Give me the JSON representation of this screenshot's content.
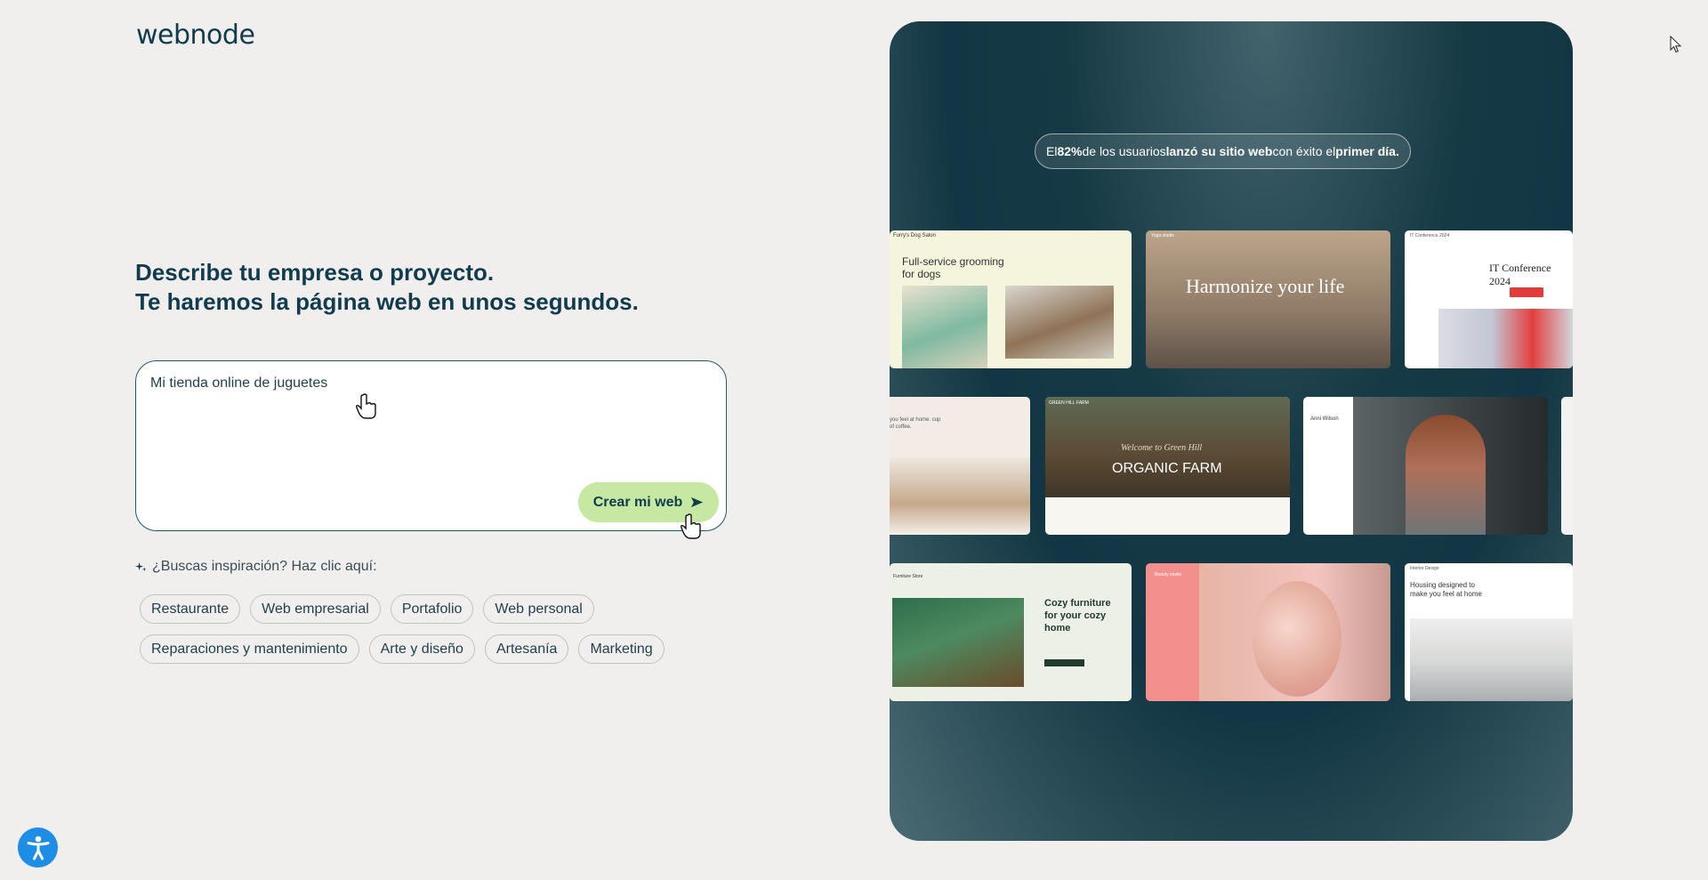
{
  "brand": {
    "logo": "webnode"
  },
  "headline": {
    "line1": "Describe tu empresa o proyecto.",
    "line2": "Te haremos la página web en unos segundos."
  },
  "prompt": {
    "value": "Mi tienda online de juguetes",
    "button_label": "Crear mi web"
  },
  "inspiration": {
    "label": "¿Buscas inspiración? Haz clic aquí:",
    "chips": [
      "Restaurante",
      "Web empresarial",
      "Portafolio",
      "Web personal",
      "Reparaciones y mantenimiento",
      "Arte y diseño",
      "Artesanía",
      "Marketing"
    ]
  },
  "hero": {
    "badge": {
      "p1": "El ",
      "b1": "82%",
      "p2": " de los usuarios ",
      "b2": "lanzó su sitio web",
      "p3": " con éxito el ",
      "b3": "primer día."
    },
    "thumbnails": {
      "dog_salon": {
        "brand": "Furry's Dog Salon",
        "headline": "Full-service grooming for dogs"
      },
      "yoga": {
        "brand": "Yoga studio",
        "headline": "Harmonize your life"
      },
      "conference": {
        "brand": "IT Conference 2024",
        "headline": "IT Conference 2024"
      },
      "coffee": {
        "text": "you feel at home. cup of coffee."
      },
      "farm": {
        "brand": "GREEN HILL FARM",
        "script": "Welcome to Green Hill",
        "headline": "ORGANIC FARM"
      },
      "portfolio": {
        "name": "Anni Wilson"
      },
      "furniture": {
        "brand": "Furniture Store",
        "headline": "Cozy furniture for your cozy home"
      },
      "beauty": {
        "brand": "Beauty studio"
      },
      "housing": {
        "brand": "Interior Design",
        "headline": "Housing designed to make you feel at home"
      }
    }
  },
  "colors": {
    "accent_button": "#c6e8a2",
    "primary_text": "#103c4e",
    "accessibility_blue": "#1e8ee4"
  }
}
